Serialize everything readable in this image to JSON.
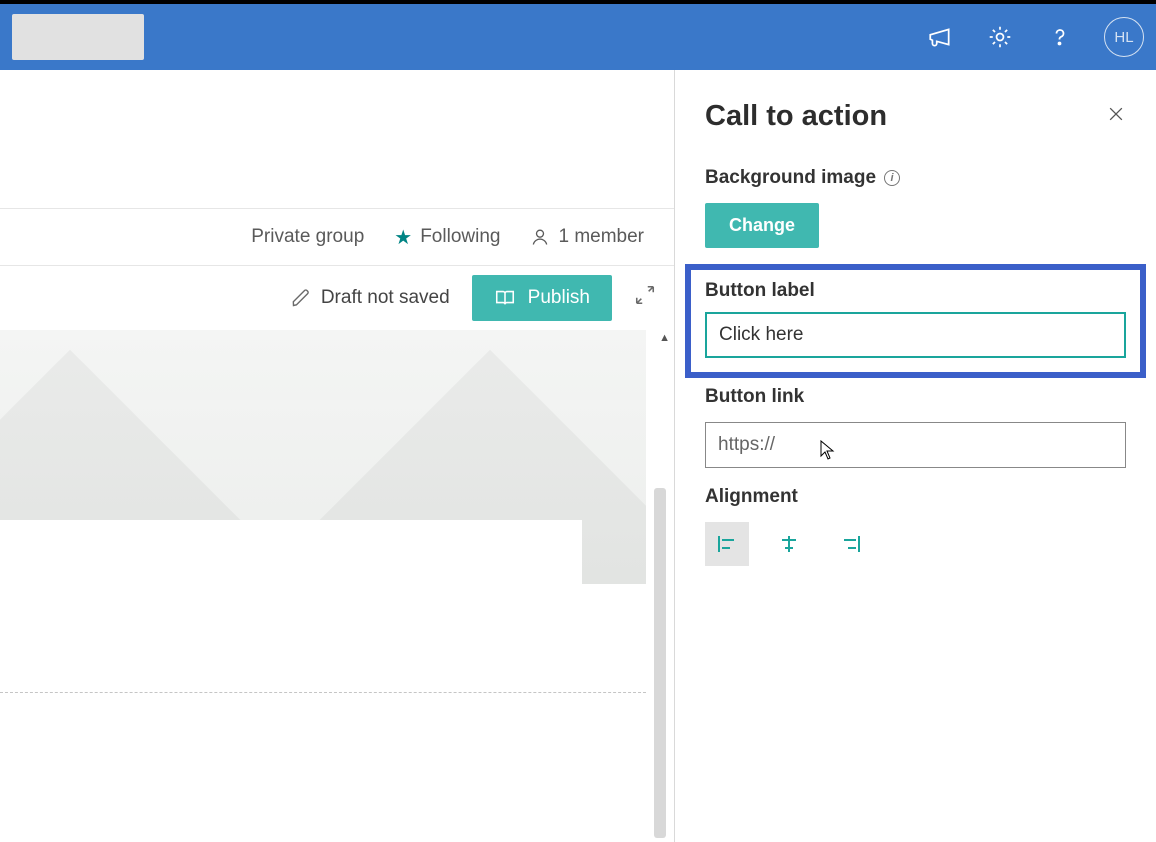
{
  "suite": {
    "avatar_initials": "HL"
  },
  "info": {
    "group_type": "Private group",
    "follow_label": "Following",
    "members_label": "1 member"
  },
  "command_bar": {
    "draft_status": "Draft not saved",
    "publish_label": "Publish"
  },
  "panel": {
    "title": "Call to action",
    "background_label": "Background image",
    "change_button": "Change",
    "button_label_heading": "Button label",
    "button_label_value": "Click here",
    "button_link_heading": "Button link",
    "button_link_placeholder": "https://",
    "alignment_heading": "Alignment"
  }
}
